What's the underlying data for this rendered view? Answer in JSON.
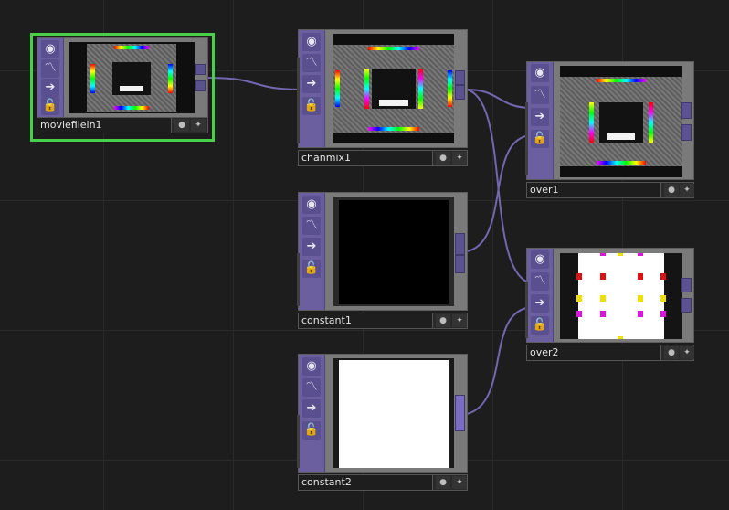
{
  "nodes": {
    "moviefilein1": {
      "name": "moviefilein1"
    },
    "chanmix1": {
      "name": "chanmix1"
    },
    "constant1": {
      "name": "constant1"
    },
    "constant2": {
      "name": "constant2"
    },
    "over1": {
      "name": "over1"
    },
    "over2": {
      "name": "over2"
    }
  },
  "icons": {
    "viewer": "◉",
    "bypass": "〽",
    "display": "➔",
    "lock": "🔓",
    "clone": "●",
    "pin": "✦"
  },
  "colors": {
    "operator_strip": "#6b5fa0",
    "wire": "#7a6bb8",
    "selected_border": "#48d048",
    "canvas_bg": "#1d1d1d"
  }
}
